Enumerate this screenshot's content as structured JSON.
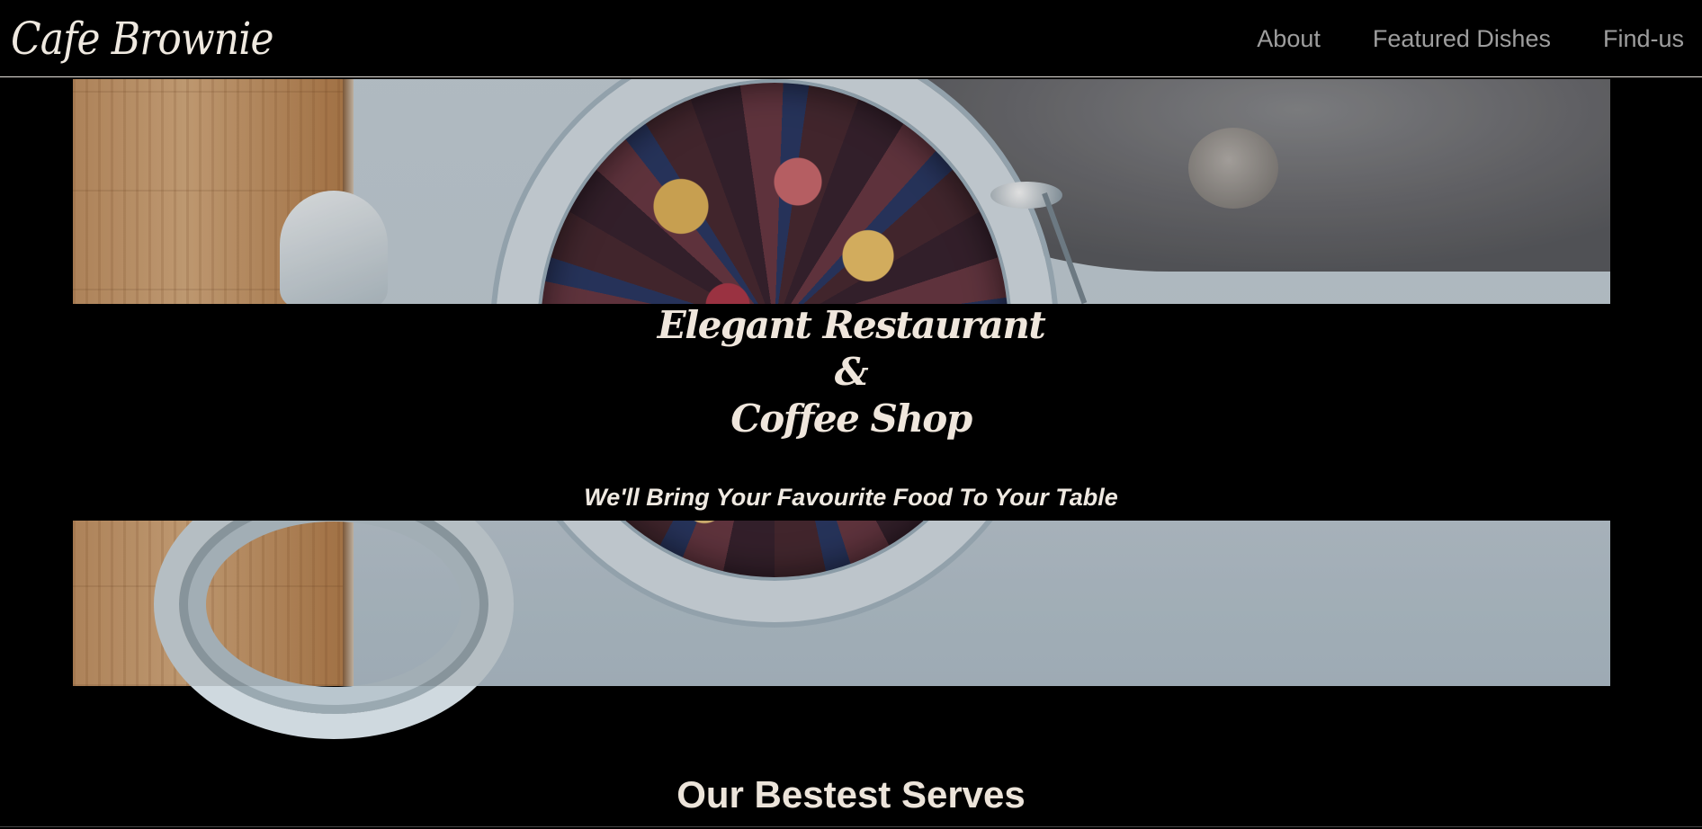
{
  "navbar": {
    "brand": "Cafe Brownie",
    "links": [
      "About",
      "Featured Dishes",
      "Find-us"
    ]
  },
  "hero": {
    "headline_lines": [
      "Elegant Restaurant",
      "&",
      "Coffee Shop"
    ],
    "tagline": "We'll Bring Your Favourite Food To Your Table"
  },
  "featured": {
    "section_title": "Our Bestest Serves"
  },
  "colors": {
    "background": "#000000",
    "text_light": "#efe9e1",
    "nav_link": "#9e9e9e"
  }
}
